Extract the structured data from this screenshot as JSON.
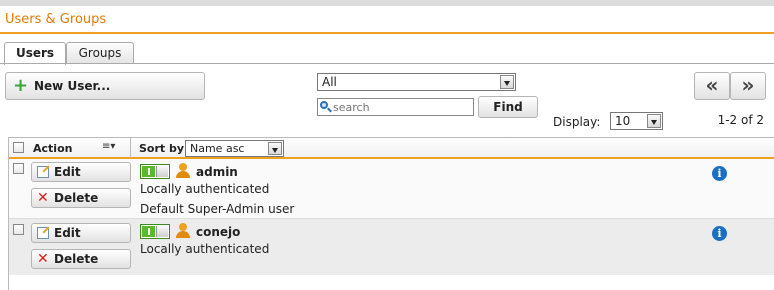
{
  "window": {
    "title": "Users & Groups"
  },
  "tabs": [
    {
      "label": "Users",
      "active": true
    },
    {
      "label": "Groups",
      "active": false
    }
  ],
  "toolbar": {
    "new_user_label": "New User...",
    "filter_value": "All",
    "search_placeholder": "search",
    "find_label": "Find",
    "prev_label": "«",
    "next_label": "»",
    "display_label": "Display:",
    "display_value": "10",
    "count_text": "1-2 of 2"
  },
  "grid": {
    "action_header": "Action",
    "sort_label": "Sort by:",
    "sort_value": "Name asc",
    "edit_label": "Edit",
    "delete_label": "Delete",
    "rows": [
      {
        "name": "admin",
        "auth": "Locally authenticated",
        "description": "Default Super-Admin user",
        "enabled": true
      },
      {
        "name": "conejo",
        "auth": "Locally authenticated",
        "description": "",
        "enabled": true
      }
    ]
  },
  "colors": {
    "accent": "#f0a020",
    "title": "#e07b00",
    "toggle_on": "#5cb82c",
    "info": "#1a6fc0"
  },
  "icons": [
    "plus-icon",
    "magnifier-icon",
    "edit-icon",
    "delete-x-icon",
    "user-icon",
    "info-icon",
    "column-menu-icon"
  ]
}
